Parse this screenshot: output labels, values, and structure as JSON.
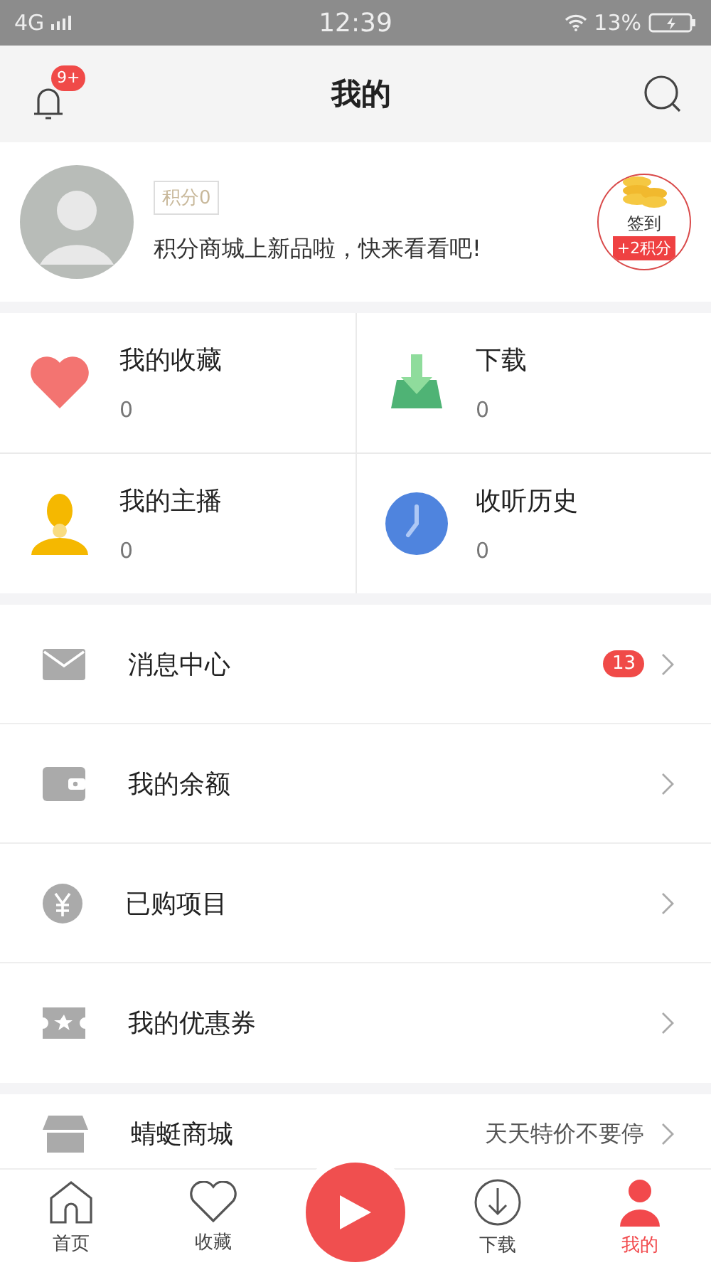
{
  "status_bar": {
    "network": "4G",
    "time": "12:39",
    "battery": "13%"
  },
  "header": {
    "title": "我的",
    "notification_badge": "9+"
  },
  "profile": {
    "points": "积分0",
    "promo": "积分商城上新品啦，快来看看吧!",
    "checkin": {
      "label": "签到",
      "reward": "+2积分"
    }
  },
  "stats": [
    {
      "kind": "favorites",
      "label": "我的收藏",
      "count": "0"
    },
    {
      "kind": "downloads",
      "label": "下载",
      "count": "0"
    },
    {
      "kind": "hosts",
      "label": "我的主播",
      "count": "0"
    },
    {
      "kind": "history",
      "label": "收听历史",
      "count": "0"
    }
  ],
  "menu": [
    {
      "kind": "mail",
      "label": "消息中心",
      "badge": "13"
    },
    {
      "kind": "wallet",
      "label": "我的余额"
    },
    {
      "kind": "yen",
      "label": "已购项目"
    },
    {
      "kind": "ticket",
      "label": "我的优惠券"
    }
  ],
  "shop": {
    "label": "蜻蜓商城",
    "hint": "天天特价不要停"
  },
  "tabs": [
    {
      "kind": "home",
      "label": "首页",
      "selected": false
    },
    {
      "kind": "heart",
      "label": "收藏",
      "selected": false
    },
    {
      "kind": "play"
    },
    {
      "kind": "download",
      "label": "下载",
      "selected": false
    },
    {
      "kind": "me",
      "label": "我的",
      "selected": true
    }
  ]
}
